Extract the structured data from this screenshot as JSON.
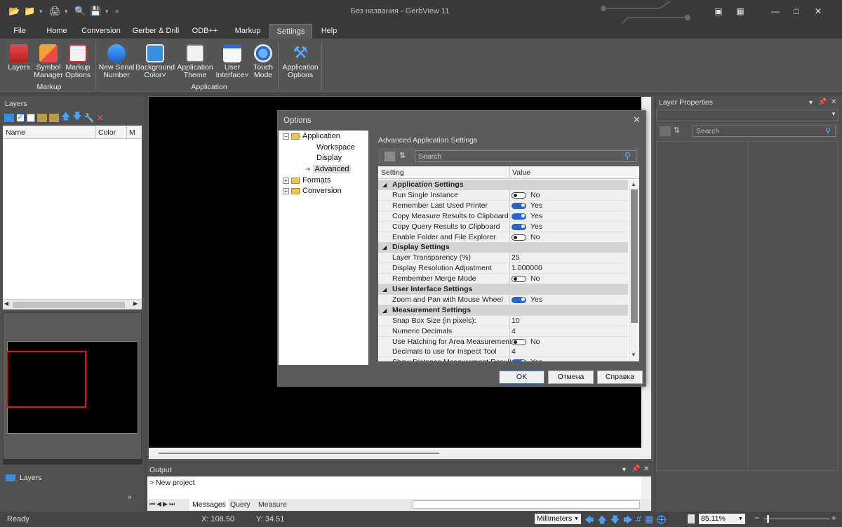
{
  "window": {
    "title": "Без названия - GerbView 11"
  },
  "menu": {
    "tabs": [
      "File",
      "Home",
      "Conversion",
      "Gerber & Drill",
      "ODB++",
      "Markup",
      "Settings",
      "Help"
    ],
    "active": "Settings"
  },
  "ribbon": {
    "markup_group": "Markup",
    "application_group": "Application",
    "buttons": [
      {
        "label1": "Layers",
        "label2": ""
      },
      {
        "label1": "Symbol",
        "label2": "Manager"
      },
      {
        "label1": "Markup",
        "label2": "Options"
      },
      {
        "label1": "New Serial",
        "label2": "Number"
      },
      {
        "label1": "Background",
        "label2": "Color"
      },
      {
        "label1": "Application",
        "label2": "Theme"
      },
      {
        "label1": "User",
        "label2": "Interface"
      },
      {
        "label1": "Touch",
        "label2": "Mode"
      },
      {
        "label1": "Application",
        "label2": "Options"
      }
    ]
  },
  "layers_panel": {
    "title": "Layers",
    "columns": {
      "name": "Name",
      "color": "Color",
      "m": "M"
    },
    "footer_label": "Layers"
  },
  "layer_properties": {
    "title": "Layer Properties",
    "search_placeholder": "Search"
  },
  "output": {
    "title": "Output",
    "line": "> New project",
    "tabs": [
      "Messages",
      "Query",
      "Measure"
    ]
  },
  "status": {
    "ready": "Ready",
    "x": "X: 108.50",
    "y": "Y: 34.51",
    "units": "Millimeters",
    "zoom": "85.11%"
  },
  "dialog": {
    "title": "Options",
    "section_title": "Advanced Application Settings",
    "search_placeholder": "Search",
    "col_setting": "Setting",
    "col_value": "Value",
    "tree": {
      "application": "Application",
      "workspace": "Workspace",
      "display": "Display",
      "advanced": "Advanced",
      "formats": "Formats",
      "conversion": "Conversion"
    },
    "rows": [
      {
        "type": "cat",
        "name": "Application Settings"
      },
      {
        "type": "toggle",
        "name": "Run Single Instance",
        "on": false,
        "value": "No"
      },
      {
        "type": "toggle",
        "name": "Remember Last Used Printer",
        "on": true,
        "value": "Yes"
      },
      {
        "type": "toggle",
        "name": "Copy Measure Results to Clipboard",
        "on": true,
        "value": "Yes"
      },
      {
        "type": "toggle",
        "name": "Copy Query Results to Clipboard",
        "on": true,
        "value": "Yes"
      },
      {
        "type": "toggle",
        "name": "Enable Folder and File Explorer",
        "on": false,
        "value": "No"
      },
      {
        "type": "cat",
        "name": "Display Settings"
      },
      {
        "type": "text",
        "name": "Layer Transparency (%)",
        "value": "25"
      },
      {
        "type": "text",
        "name": "Display Resolution Adjustment",
        "value": "1.000000"
      },
      {
        "type": "toggle",
        "name": "Rembember Merge Mode",
        "on": false,
        "value": "No"
      },
      {
        "type": "cat",
        "name": "User Interface Settings"
      },
      {
        "type": "toggle",
        "name": "Zoom and Pan with Mouse Wheel",
        "on": true,
        "value": "Yes"
      },
      {
        "type": "cat",
        "name": "Measurement Settings"
      },
      {
        "type": "text",
        "name": "Snap Box Size (in pixels):",
        "value": "10"
      },
      {
        "type": "text",
        "name": "Numeric Decimals",
        "value": "4"
      },
      {
        "type": "toggle",
        "name": "Use Hatching for Area Measurement",
        "on": false,
        "value": "No"
      },
      {
        "type": "text",
        "name": "Decimals to use for Inspect Tool",
        "value": "4"
      },
      {
        "type": "toggle",
        "name": "Show Distance Measurement Result",
        "on": true,
        "value": "Yes"
      }
    ],
    "ok": "OK",
    "cancel": "Отмена",
    "help": "Справка"
  },
  "colors": {
    "accent": "#2a62c8",
    "chrome": "#3a3a3a",
    "panel": "#505050",
    "selection_rect": "#e0141e"
  }
}
